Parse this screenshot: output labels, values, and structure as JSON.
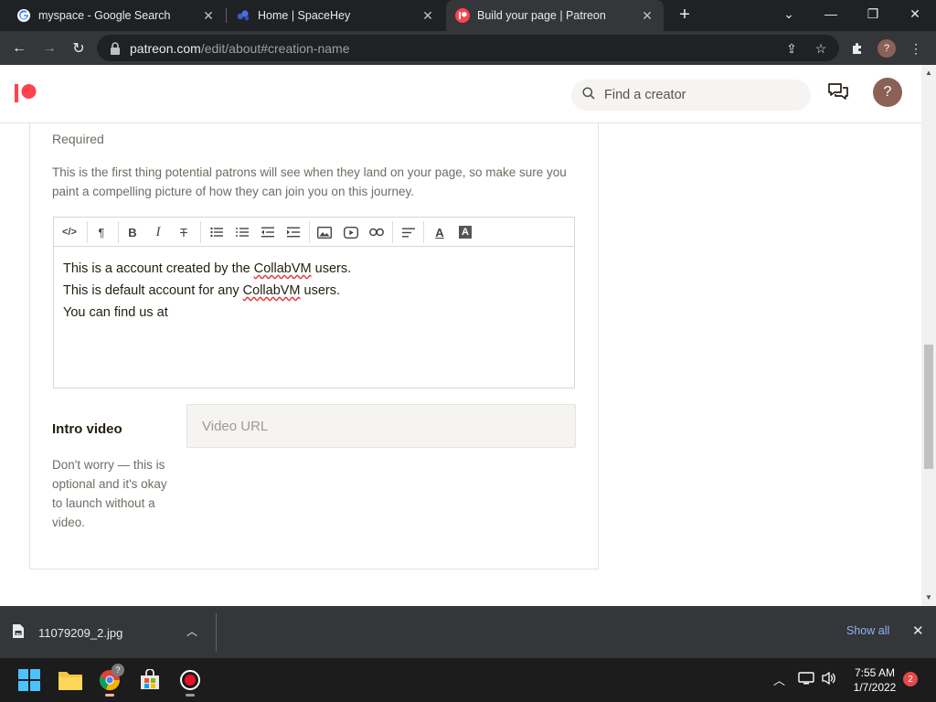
{
  "browser": {
    "tabs": [
      {
        "title": "myspace - Google Search",
        "active": false,
        "favicon": "google-icon"
      },
      {
        "title": "Home | SpaceHey",
        "active": false,
        "favicon": "spacehey-icon"
      },
      {
        "title": "Build your page | Patreon",
        "active": true,
        "favicon": "patreon-icon"
      }
    ],
    "url_host": "patreon.com",
    "url_path": "/edit/about#creation-name"
  },
  "page": {
    "search_placeholder": "Find a creator",
    "avatar_label": "?",
    "required_label": "Required",
    "help_text": "This is the first thing potential patrons will see when they land on your page, so make sure you paint a compelling picture of how they can join you on this journey.",
    "editor": {
      "lines": [
        {
          "before": "This is a account created by the ",
          "misspelled": "CollabVM",
          "after": " users."
        },
        {
          "before": "This is default account for any ",
          "misspelled": "CollabVM",
          "after": " users."
        },
        {
          "before": "You can find us at",
          "misspelled": "",
          "after": ""
        }
      ]
    },
    "intro_video": {
      "title": "Intro video",
      "placeholder": "Video URL",
      "description": "Don't worry — this is optional and it's okay to launch without a video."
    }
  },
  "download_bar": {
    "filename": "11079209_2.jpg",
    "show_all_label": "Show all"
  },
  "taskbar": {
    "chrome_badge": "?",
    "time": "7:55 AM",
    "date": "1/7/2022",
    "notification_count": "2"
  },
  "colors": {
    "patreon_brand": "#ff424d",
    "chrome_dark": "#202124",
    "chrome_toolbar": "#35363a",
    "link_blue": "#8ab4f8"
  }
}
